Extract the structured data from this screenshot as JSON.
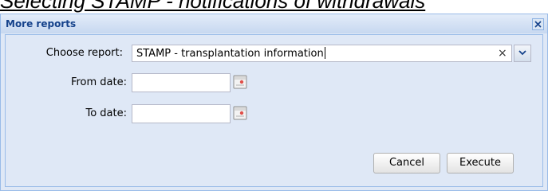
{
  "caption": "Selecting STAMP - notifications of withdrawals",
  "window": {
    "title": "More reports",
    "close_icon": "close-icon"
  },
  "form": {
    "report_label": "Choose report:",
    "report_value": "STAMP - transplantation information",
    "clear_icon_glyph": "×",
    "from_label": "From date:",
    "from_value": "",
    "to_label": "To date:",
    "to_value": ""
  },
  "buttons": {
    "cancel": "Cancel",
    "execute": "Execute"
  },
  "icons": {
    "dropdown": "chevron-down-icon",
    "calendar": "calendar-icon",
    "clear": "clear-icon"
  },
  "colors": {
    "title_text": "#15428b",
    "window_border": "#99bbe8",
    "panel_bg": "#dfe8f6"
  }
}
